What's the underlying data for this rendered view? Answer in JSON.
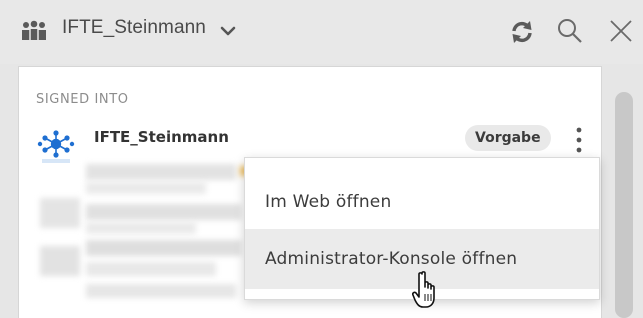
{
  "header": {
    "hub_name": "IFTE_Steinmann",
    "icons": {
      "team": "team-icon",
      "chevron": "chevron-down-icon",
      "refresh": "refresh-icon",
      "search": "search-icon",
      "close": "close-icon"
    }
  },
  "panel": {
    "section_label": "SIGNED INTO",
    "account": {
      "name": "IFTE_Steinmann",
      "badge": "Vorgabe",
      "logo_icon": "hub-logo-icon",
      "more_icon": "kebab-menu-icon"
    }
  },
  "context_menu": {
    "items": [
      {
        "label": "Im Web öffnen"
      },
      {
        "label": "Administrator-Konsole öffnen",
        "hovered": true
      }
    ]
  },
  "colors": {
    "header_bg": "#e8e8e8",
    "panel_bg": "#ffffff",
    "logo_blue": "#1f6fd1",
    "menu_hover": "#ebebeb"
  }
}
